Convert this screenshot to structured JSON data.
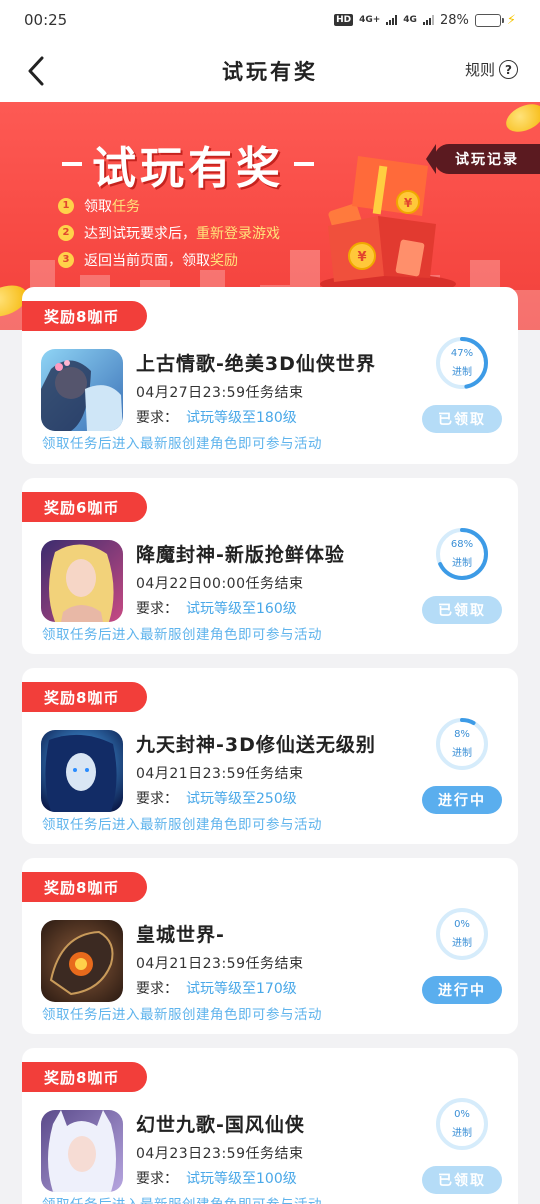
{
  "status_bar": {
    "time": "00:25",
    "hd": "HD",
    "net1": "4G+",
    "net2": "4G",
    "battery": "28%",
    "battery_level": 0.28
  },
  "header": {
    "title": "试玩有奖",
    "rules_label": "规则",
    "help_glyph": "?"
  },
  "banner": {
    "title": "试玩有奖",
    "record_button": "试玩记录",
    "steps": [
      {
        "num": "1",
        "text": "领取",
        "highlight": "任务"
      },
      {
        "num": "2",
        "text": "达到试玩要求后，",
        "highlight": "重新登录游戏"
      },
      {
        "num": "3",
        "text": "返回当前页面，领取",
        "highlight": "奖励"
      }
    ]
  },
  "tasks": [
    {
      "reward": "奖励8咖币",
      "name": "上古情歌-绝美3D仙侠世界",
      "deadline": "04月27日23:59任务结束",
      "req_label": "要求：",
      "req_level": "试玩等级至180级",
      "note": "领取任务后进入最新服创建角色即可参与活动",
      "progress_pct": "47%",
      "progress_value": 47,
      "progress_label": "进制",
      "status": "已领取",
      "status_type": "done",
      "icon": "game-icon-fairy"
    },
    {
      "reward": "奖励6咖币",
      "name": "降魔封神-新版抢鲜体验",
      "deadline": "04月22日00:00任务结束",
      "req_label": "要求：",
      "req_level": "试玩等级至160级",
      "note": "领取任务后进入最新服创建角色即可参与活动",
      "progress_pct": "68%",
      "progress_value": 68,
      "progress_label": "进制",
      "status": "已领取",
      "status_type": "done",
      "icon": "game-icon-blonde"
    },
    {
      "reward": "奖励8咖币",
      "name": "九天封神-3D修仙送无级别",
      "deadline": "04月21日23:59任务结束",
      "req_label": "要求：",
      "req_level": "试玩等级至250级",
      "note": "领取任务后进入最新服创建角色即可参与活动",
      "progress_pct": "8%",
      "progress_value": 8,
      "progress_label": "进制",
      "status": "进行中",
      "status_type": "going",
      "icon": "game-icon-blue-warrior"
    },
    {
      "reward": "奖励8咖币",
      "name": "皇城世界-",
      "deadline": "04月21日23:59任务结束",
      "req_label": "要求：",
      "req_level": "试玩等级至170级",
      "note": "领取任务后进入最新服创建角色即可参与活动",
      "progress_pct": "0%",
      "progress_value": 0,
      "progress_label": "进制",
      "status": "进行中",
      "status_type": "going",
      "icon": "game-icon-dragon"
    },
    {
      "reward": "奖励8咖币",
      "name": "幻世九歌-国风仙侠",
      "deadline": "04月23日23:59任务结束",
      "req_label": "要求：",
      "req_level": "试玩等级至100级",
      "note": "领取任务后进入最新服创建角色即可参与活动",
      "progress_pct": "0%",
      "progress_value": 0,
      "progress_label": "进制",
      "status": "已领取",
      "status_type": "done",
      "icon": "game-icon-white-hair"
    }
  ],
  "colors": {
    "banner_red": "#f84b45",
    "tag_red": "#f23e3a",
    "accent_blue": "#5aaeee",
    "done_blue": "#b5dcf7",
    "highlight_yellow": "#ffe27a"
  }
}
